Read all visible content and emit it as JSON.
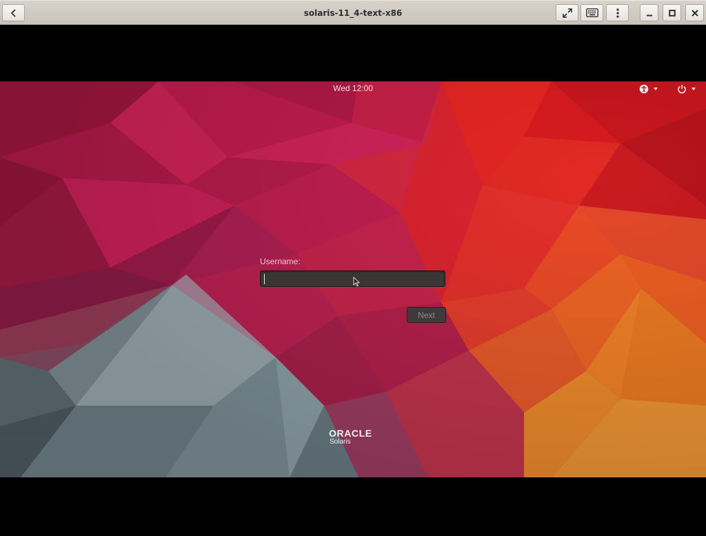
{
  "window": {
    "title": "solaris-11_4-text-x86",
    "buttons": {
      "back": "back-icon",
      "fullscreen": "fullscreen-icon",
      "keyboard": "keyboard-icon",
      "menu": "more-vertical-icon",
      "minimize": "minimize-icon",
      "maximize": "maximize-icon",
      "close": "close-icon"
    }
  },
  "topbar": {
    "clock": "Wed 12:00",
    "indicators": [
      "accessibility-icon",
      "power-icon"
    ]
  },
  "login": {
    "username_label": "Username:",
    "username_value": "",
    "next_label": "Next"
  },
  "branding": {
    "logo": "ORACLE",
    "product": "Solaris"
  },
  "colors": {
    "titlebar": "#d3cfc7",
    "wallpaper_magenta": "#c41a4d",
    "wallpaper_red": "#e02222",
    "wallpaper_orange": "#e8701f",
    "wallpaper_slate": "#6c8089",
    "input_bg": "#3a3636"
  }
}
